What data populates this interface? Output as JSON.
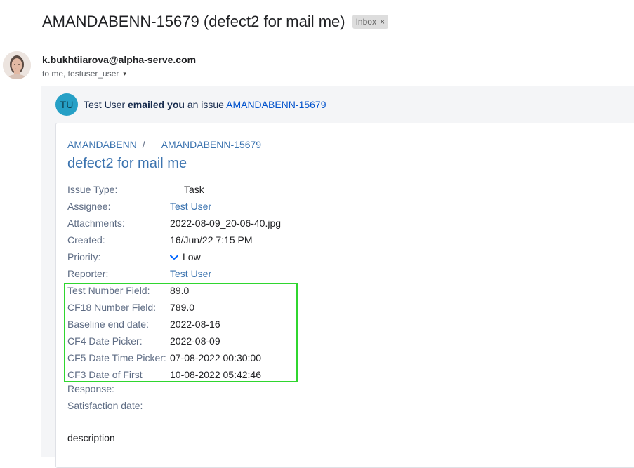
{
  "subject": {
    "title": "AMANDABENN-15679 (defect2 for mail me)",
    "badge_label": "Inbox",
    "badge_close": "×"
  },
  "sender": {
    "email": "k.bukhtiiarova@alpha-serve.com",
    "recipients": "to me, testuser_user",
    "caret": "▾"
  },
  "notification": {
    "avatar_initials": "TU",
    "actor": "Test User",
    "action": "emailed you",
    "middle": "an issue",
    "issue_link": "AMANDABENN-15679"
  },
  "issue": {
    "project": "AMANDABENN",
    "separator": "/",
    "key": "AMANDABENN-15679",
    "title": "defect2 for mail me",
    "fields": [
      {
        "label": "Issue Type:",
        "value": "Task"
      },
      {
        "label": "Assignee:",
        "value": "Test User"
      },
      {
        "label": "Attachments:",
        "value": "2022-08-09_20-06-40.jpg"
      },
      {
        "label": "Created:",
        "value": "16/Jun/22 7:15 PM"
      },
      {
        "label": "Priority:",
        "value": "Low"
      },
      {
        "label": "Reporter:",
        "value": "Test User"
      },
      {
        "label": "Test Number Field:",
        "value": "89.0"
      },
      {
        "label": "CF18 Number Field:",
        "value": "789.0"
      },
      {
        "label": "Baseline end date:",
        "value": "2022-08-16"
      },
      {
        "label": "CF4 Date Picker:",
        "value": "2022-08-09"
      },
      {
        "label": "CF5 Date Time Picker:",
        "value": "07-08-2022 00:30:00"
      },
      {
        "label": "CF3 Date of First",
        "value": "10-08-2022 05:42:46"
      },
      {
        "label": "Response:",
        "value": ""
      },
      {
        "label": "Satisfaction date:",
        "value": ""
      }
    ],
    "description": "description"
  },
  "colors": {
    "link": "#3b73af",
    "highlight_box": "#2fd62f",
    "avatar_tu": "#26a0c6"
  }
}
